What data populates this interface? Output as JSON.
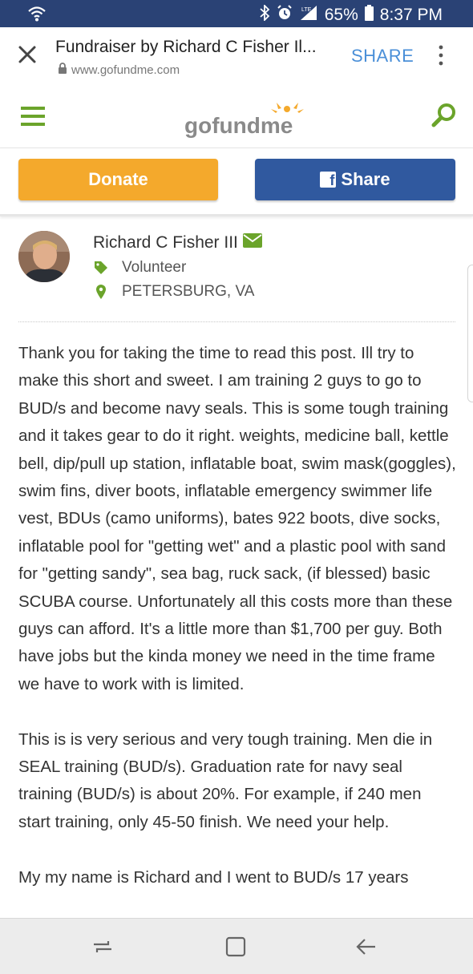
{
  "status": {
    "battery": "65%",
    "time": "8:37 PM",
    "network": "LTE"
  },
  "browser": {
    "title": "Fundraiser by Richard C Fisher Il...",
    "url": "www.gofundme.com",
    "share_label": "SHARE"
  },
  "site": {
    "logo_text": "gofundme",
    "brand_color": "#6ba42b"
  },
  "actions": {
    "donate_label": "Donate",
    "share_label": "Share"
  },
  "organizer": {
    "name": "Richard C Fisher III",
    "role": "Volunteer",
    "location": "PETERSBURG, VA"
  },
  "story": {
    "paragraphs": [
      "Thank you for taking the time to read this post. Ill try to make this short and sweet. I am training 2 guys to go to BUD/s and become navy seals. This is some tough training and it takes gear to do it right. weights, medicine ball, kettle bell, dip/pull up station, inflatable boat, swim mask(goggles), swim fins, diver boots, inflatable emergency swimmer life vest, BDUs (camo uniforms), bates 922 boots, dive socks, inflatable pool for \"getting wet\" and a plastic pool with sand for \"getting sandy\", sea bag, ruck sack, (if blessed) basic SCUBA course. Unfortunately all this costs more than these guys can afford. It's a little more than $1,700 per guy. Both have jobs but the kinda money we need in the time frame we have to work with is limited.",
      "This is is very serious and very tough training. Men die in SEAL training (BUD/s). Graduation rate for navy seal training (BUD/s) is about 20%. For example, if 240 men start training, only 45-50 finish. We need your help.",
      "My my name is Richard and I went to BUD/s 17 years"
    ]
  }
}
